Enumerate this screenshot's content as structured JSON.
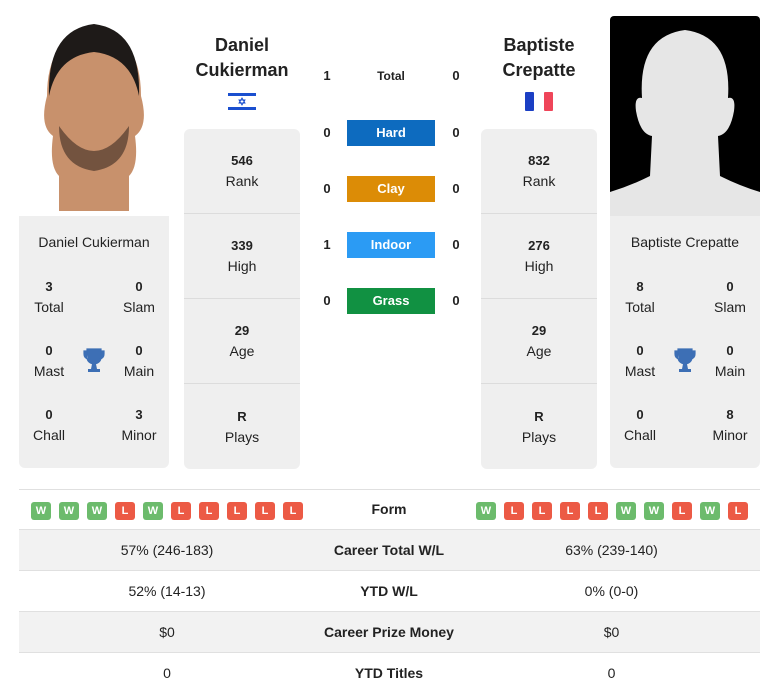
{
  "player1": {
    "name_line1": "Daniel",
    "name_line2": "Cukierman",
    "full_name": "Daniel Cukierman",
    "flag": "israel-flag",
    "rank": "546",
    "rank_label": "Rank",
    "high": "339",
    "high_label": "High",
    "age": "29",
    "age_label": "Age",
    "plays": "R",
    "plays_label": "Plays",
    "titles": {
      "total": "3",
      "total_label": "Total",
      "slam": "0",
      "slam_label": "Slam",
      "mast": "0",
      "mast_label": "Mast",
      "main": "0",
      "main_label": "Main",
      "chall": "0",
      "chall_label": "Chall",
      "minor": "3",
      "minor_label": "Minor"
    },
    "form": [
      "W",
      "W",
      "W",
      "L",
      "W",
      "L",
      "L",
      "L",
      "L",
      "L"
    ]
  },
  "player2": {
    "name_line1": "Baptiste",
    "name_line2": "Crepatte",
    "full_name": "Baptiste Crepatte",
    "flag": "france-flag",
    "rank": "832",
    "rank_label": "Rank",
    "high": "276",
    "high_label": "High",
    "age": "29",
    "age_label": "Age",
    "plays": "R",
    "plays_label": "Plays",
    "titles": {
      "total": "8",
      "total_label": "Total",
      "slam": "0",
      "slam_label": "Slam",
      "mast": "0",
      "mast_label": "Mast",
      "main": "0",
      "main_label": "Main",
      "chall": "0",
      "chall_label": "Chall",
      "minor": "8",
      "minor_label": "Minor"
    },
    "form": [
      "W",
      "L",
      "L",
      "L",
      "L",
      "W",
      "W",
      "L",
      "W",
      "L"
    ]
  },
  "h2h": {
    "total": {
      "label": "Total",
      "p1": "1",
      "p2": "0"
    },
    "surfaces": [
      {
        "label": "Hard",
        "p1": "0",
        "p2": "0",
        "color": "#0d6bbf"
      },
      {
        "label": "Clay",
        "p1": "0",
        "p2": "0",
        "color": "#dc8c06"
      },
      {
        "label": "Indoor",
        "p1": "1",
        "p2": "0",
        "color": "#2b9bf4"
      },
      {
        "label": "Grass",
        "p1": "0",
        "p2": "0",
        "color": "#119142"
      }
    ]
  },
  "form_label": "Form",
  "stats": [
    {
      "label": "Career Total W/L",
      "p1": "57% (246-183)",
      "p2": "63% (239-140)"
    },
    {
      "label": "YTD W/L",
      "p1": "52% (14-13)",
      "p2": "0% (0-0)"
    },
    {
      "label": "Career Prize Money",
      "p1": "$0",
      "p2": "$0"
    },
    {
      "label": "YTD Titles",
      "p1": "0",
      "p2": "0"
    }
  ]
}
